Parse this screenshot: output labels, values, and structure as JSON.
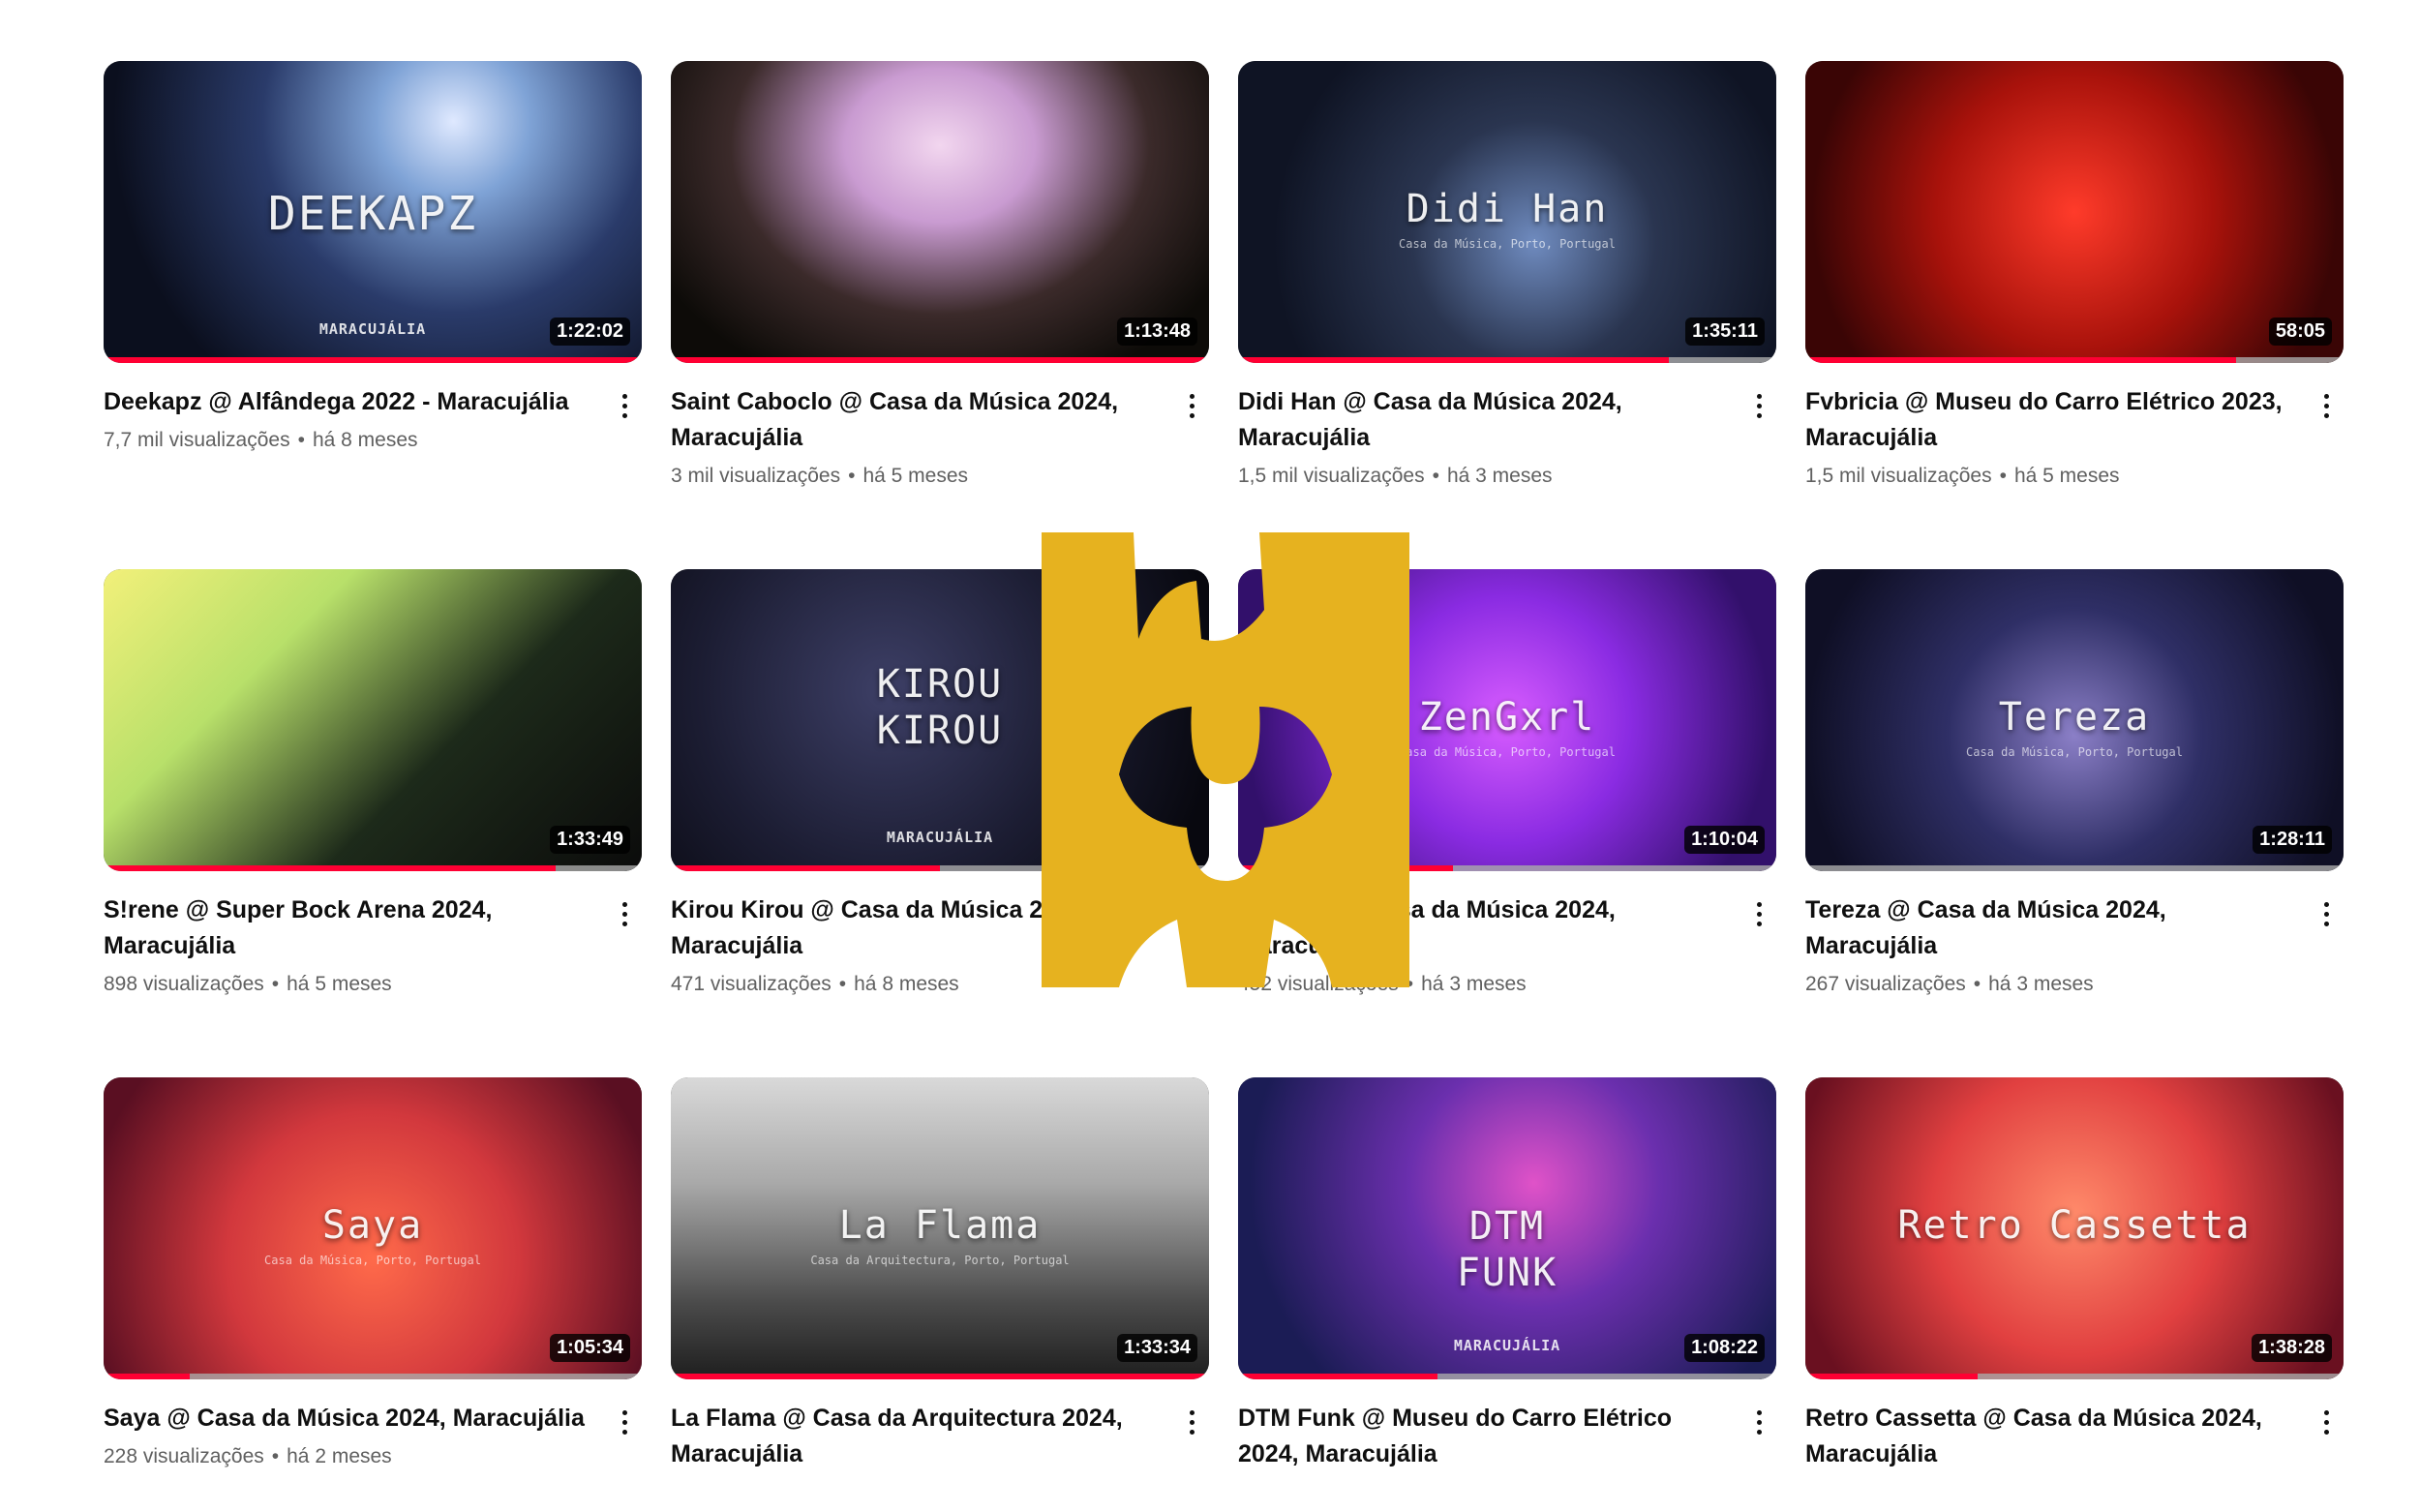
{
  "colors": {
    "progress": "#ff0033",
    "logo": "#e6b21f",
    "meta_text": "#606060"
  },
  "videos": [
    {
      "title": "Deekapz @ Alfândega 2022 - Maracujália",
      "views": "7,7 mil visualizações",
      "age": "há 8 meses",
      "duration": "1:22:02",
      "overlay": "DEEKAPZ",
      "overlay_sub": "",
      "brand": "MARACUJÁLIA",
      "watched": 1.0
    },
    {
      "title": "Saint Caboclo @ Casa da Música 2024, Maracujália",
      "views": "3 mil visualizações",
      "age": "há 5 meses",
      "duration": "1:13:48",
      "overlay": "",
      "overlay_sub": "",
      "brand": "",
      "watched": 1.0
    },
    {
      "title": "Didi Han @ Casa da Música 2024, Maracujália",
      "views": "1,5 mil visualizações",
      "age": "há 3 meses",
      "duration": "1:35:11",
      "overlay": "Didi Han",
      "overlay_sub": "Casa da Música, Porto, Portugal",
      "brand": "",
      "watched": 0.8
    },
    {
      "title": "Fvbricia @ Museu do Carro Elétrico 2023, Maracujália",
      "views": "1,5 mil visualizações",
      "age": "há 5 meses",
      "duration": "58:05",
      "overlay": "",
      "overlay_sub": "",
      "brand": "",
      "watched": 0.8
    },
    {
      "title": "S!rene @ Super Bock Arena 2024, Maracujália",
      "views": "898 visualizações",
      "age": "há 5 meses",
      "duration": "1:33:49",
      "overlay": "",
      "overlay_sub": "",
      "brand": "",
      "watched": 0.84
    },
    {
      "title": "Kirou Kirou @ Casa da Música 2024, Maracujália",
      "views": "471 visualizações",
      "age": "há 8 meses",
      "duration": "",
      "overlay": "KIROU KIROU",
      "overlay_sub": "",
      "brand": "MARACUJÁLIA",
      "watched": 0.5
    },
    {
      "title": "ZenGxrl @ Casa da Música 2024, Maracujália",
      "views": "452 visualizações",
      "age": "há 3 meses",
      "duration": "1:10:04",
      "overlay": "ZenGxrl",
      "overlay_sub": "Casa da Música, Porto, Portugal",
      "brand": "",
      "watched": 0.4
    },
    {
      "title": "Tereza @ Casa da Música 2024, Maracujália",
      "views": "267 visualizações",
      "age": "há 3 meses",
      "duration": "1:28:11",
      "overlay": "Tereza",
      "overlay_sub": "Casa da Música, Porto, Portugal",
      "brand": "",
      "watched": 0
    },
    {
      "title": "Saya @ Casa da Música 2024, Maracujália",
      "views": "228 visualizações",
      "age": "há 2 meses",
      "duration": "1:05:34",
      "overlay": "Saya",
      "overlay_sub": "Casa da Música, Porto, Portugal",
      "brand": "",
      "watched": 0.16
    },
    {
      "title": "La Flama @ Casa da Arquitectura 2024, Maracujália",
      "views": "",
      "age": "",
      "duration": "1:33:34",
      "overlay": "La Flama",
      "overlay_sub": "Casa da Arquitectura, Porto, Portugal",
      "brand": "",
      "watched": 1.0
    },
    {
      "title": "DTM Funk @ Museu do Carro Elétrico 2024, Maracujália",
      "views": "",
      "age": "",
      "duration": "1:08:22",
      "overlay": "DTM FUNK",
      "overlay_sub": "",
      "brand": "MARACUJÁLIA",
      "watched": 0.37
    },
    {
      "title": "Retro Cassetta @ Casa da Música 2024, Maracujália",
      "views": "",
      "age": "",
      "duration": "1:38:28",
      "overlay": "Retro Cassetta",
      "overlay_sub": "",
      "brand": "",
      "watched": 0.32
    }
  ]
}
